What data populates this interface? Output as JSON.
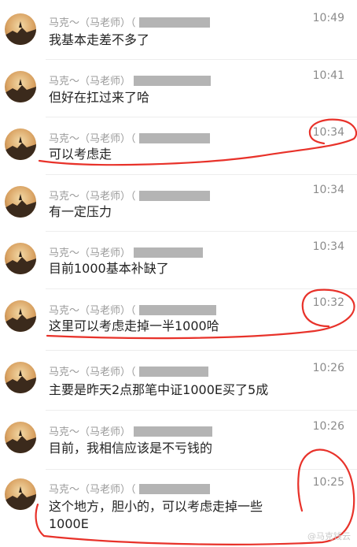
{
  "messages": [
    {
      "sender": "马克～（马老师）（",
      "time": "10:49",
      "text": "我基本走差不多了"
    },
    {
      "sender": "马克～（马老师）",
      "time": "10:41",
      "text": "但好在扛过来了哈"
    },
    {
      "sender": "马克～（马老师）（",
      "time": "10:34",
      "text": "可以考虑走"
    },
    {
      "sender": "马克～（马老师）（",
      "time": "10:34",
      "text": "有一定压力"
    },
    {
      "sender": "马克～（马老师）",
      "time": "10:34",
      "text": "目前1000基本补缺了"
    },
    {
      "sender": "马克～（马老师）（",
      "time": "10:32",
      "text": "这里可以考虑走掉一半1000哈"
    },
    {
      "sender": "马克～（马老师）（",
      "time": "10:26",
      "text": "主要是昨天2点那笔中证1000E买了5成"
    },
    {
      "sender": "马克～（马老师）",
      "time": "10:26",
      "text": "目前，我相信应该是不亏钱的"
    },
    {
      "sender": "马克～（马老师）（",
      "time": "10:25",
      "text": "这个地方，胆小的，可以考虑走掉一些1000E"
    }
  ],
  "watermark": "@马克钱云",
  "colors": {
    "annotation": "#e8322a"
  }
}
